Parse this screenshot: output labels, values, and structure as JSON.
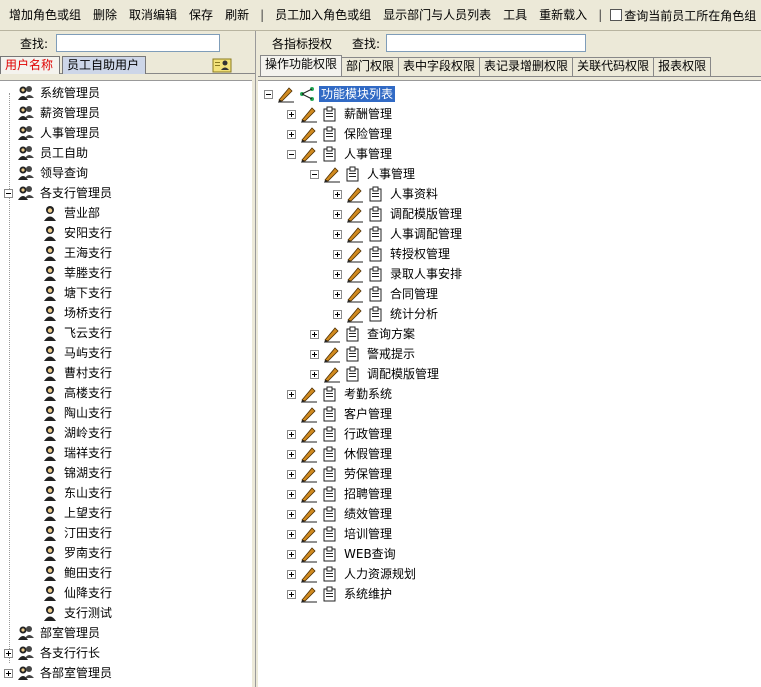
{
  "toolbar": {
    "btn_add_group": "增加角色或组",
    "btn_delete": "删除",
    "btn_cancel_edit": "取消编辑",
    "btn_save": "保存",
    "btn_refresh": "刷新",
    "btn_join": "员工加入角色或组",
    "btn_show_dept": "显示部门与人员列表",
    "btn_tools": "工具",
    "btn_reload": "重新载入",
    "check_query": "查询当前员工所在角色组"
  },
  "left": {
    "search_label": "查找:",
    "search_value": "",
    "tab_users": "用户名称",
    "tab_self": "员工自助用户",
    "tree": [
      {
        "label": "系统管理员",
        "level": 0,
        "exp": "none",
        "icon": "group"
      },
      {
        "label": "薪资管理员",
        "level": 0,
        "exp": "none",
        "icon": "group"
      },
      {
        "label": "人事管理员",
        "level": 0,
        "exp": "none",
        "icon": "group"
      },
      {
        "label": "员工自助",
        "level": 0,
        "exp": "none",
        "icon": "group"
      },
      {
        "label": "领导查询",
        "level": 0,
        "exp": "none",
        "icon": "group"
      },
      {
        "label": "各支行管理员",
        "level": 0,
        "exp": "minus",
        "icon": "group"
      },
      {
        "label": "营业部",
        "level": 1,
        "exp": "none",
        "icon": "user"
      },
      {
        "label": "安阳支行",
        "level": 1,
        "exp": "none",
        "icon": "user"
      },
      {
        "label": "王海支行",
        "level": 1,
        "exp": "none",
        "icon": "user"
      },
      {
        "label": "莘塍支行",
        "level": 1,
        "exp": "none",
        "icon": "user"
      },
      {
        "label": "塘下支行",
        "level": 1,
        "exp": "none",
        "icon": "user"
      },
      {
        "label": "场桥支行",
        "level": 1,
        "exp": "none",
        "icon": "user"
      },
      {
        "label": "飞云支行",
        "level": 1,
        "exp": "none",
        "icon": "user"
      },
      {
        "label": "马屿支行",
        "level": 1,
        "exp": "none",
        "icon": "user"
      },
      {
        "label": "曹村支行",
        "level": 1,
        "exp": "none",
        "icon": "user"
      },
      {
        "label": "高楼支行",
        "level": 1,
        "exp": "none",
        "icon": "user"
      },
      {
        "label": "陶山支行",
        "level": 1,
        "exp": "none",
        "icon": "user"
      },
      {
        "label": "湖岭支行",
        "level": 1,
        "exp": "none",
        "icon": "user"
      },
      {
        "label": "瑞祥支行",
        "level": 1,
        "exp": "none",
        "icon": "user"
      },
      {
        "label": "锦湖支行",
        "level": 1,
        "exp": "none",
        "icon": "user"
      },
      {
        "label": "东山支行",
        "level": 1,
        "exp": "none",
        "icon": "user"
      },
      {
        "label": "上望支行",
        "level": 1,
        "exp": "none",
        "icon": "user"
      },
      {
        "label": "汀田支行",
        "level": 1,
        "exp": "none",
        "icon": "user"
      },
      {
        "label": "罗南支行",
        "level": 1,
        "exp": "none",
        "icon": "user"
      },
      {
        "label": "鲍田支行",
        "level": 1,
        "exp": "none",
        "icon": "user"
      },
      {
        "label": "仙降支行",
        "level": 1,
        "exp": "none",
        "icon": "user"
      },
      {
        "label": "支行测试",
        "level": 1,
        "exp": "none",
        "icon": "user"
      },
      {
        "label": "部室管理员",
        "level": 0,
        "exp": "none",
        "icon": "group"
      },
      {
        "label": "各支行行长",
        "level": 0,
        "exp": "plus",
        "icon": "group"
      },
      {
        "label": "各部室管理员",
        "level": 0,
        "exp": "plus",
        "icon": "group"
      }
    ]
  },
  "right": {
    "label_auth": "各指标授权",
    "search_label": "查找:",
    "search_value": "",
    "tabs": [
      "操作功能权限",
      "部门权限",
      "表中字段权限",
      "表记录增删权限",
      "关联代码权限",
      "报表权限"
    ],
    "tree": [
      {
        "label": "功能模块列表",
        "level": 0,
        "exp": "minus",
        "selected": true,
        "root": true
      },
      {
        "label": "薪酬管理",
        "level": 1,
        "exp": "plus"
      },
      {
        "label": "保险管理",
        "level": 1,
        "exp": "plus"
      },
      {
        "label": "人事管理",
        "level": 1,
        "exp": "minus"
      },
      {
        "label": "人事管理",
        "level": 2,
        "exp": "minus"
      },
      {
        "label": "人事资料",
        "level": 3,
        "exp": "plus"
      },
      {
        "label": "调配模版管理",
        "level": 3,
        "exp": "plus"
      },
      {
        "label": "人事调配管理",
        "level": 3,
        "exp": "plus"
      },
      {
        "label": "转授权管理",
        "level": 3,
        "exp": "plus"
      },
      {
        "label": "录取人事安排",
        "level": 3,
        "exp": "plus"
      },
      {
        "label": "合同管理",
        "level": 3,
        "exp": "plus"
      },
      {
        "label": "统计分析",
        "level": 3,
        "exp": "plus"
      },
      {
        "label": "查询方案",
        "level": 2,
        "exp": "plus"
      },
      {
        "label": "警戒提示",
        "level": 2,
        "exp": "plus"
      },
      {
        "label": "调配模版管理",
        "level": 2,
        "exp": "plus"
      },
      {
        "label": "考勤系统",
        "level": 1,
        "exp": "plus"
      },
      {
        "label": "客户管理",
        "level": 1,
        "exp": "none"
      },
      {
        "label": "行政管理",
        "level": 1,
        "exp": "plus"
      },
      {
        "label": "休假管理",
        "level": 1,
        "exp": "plus"
      },
      {
        "label": "劳保管理",
        "level": 1,
        "exp": "plus"
      },
      {
        "label": "招聘管理",
        "level": 1,
        "exp": "plus"
      },
      {
        "label": "绩效管理",
        "level": 1,
        "exp": "plus"
      },
      {
        "label": "培训管理",
        "level": 1,
        "exp": "plus"
      },
      {
        "label": "WEB查询",
        "level": 1,
        "exp": "plus"
      },
      {
        "label": "人力资源规划",
        "level": 1,
        "exp": "plus"
      },
      {
        "label": "系统维护",
        "level": 1,
        "exp": "plus"
      }
    ]
  }
}
